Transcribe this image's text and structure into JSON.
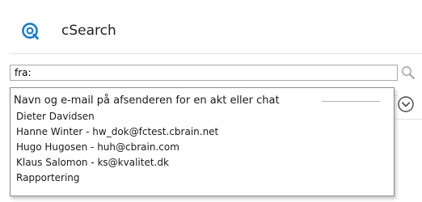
{
  "app": {
    "title": "cSearch",
    "icon": "csearch-logo-icon",
    "accent_color": "#1e7fc2"
  },
  "search": {
    "value": "fra:",
    "placeholder": "",
    "button_icon": "search-icon"
  },
  "expand_icon": "chevron-down-circle-icon",
  "suggestions": {
    "header": "Navn og e-mail på afsenderen for en akt eller chat",
    "items": [
      {
        "label": "Dieter Davidsen"
      },
      {
        "label": "Hanne Winter - hw_dok@fctest.cbrain.net"
      },
      {
        "label": "Hugo Hugosen - huh@cbrain.com"
      },
      {
        "label": "Klaus Salomon - ks@kvalitet.dk"
      },
      {
        "label": "Rapportering"
      }
    ]
  }
}
